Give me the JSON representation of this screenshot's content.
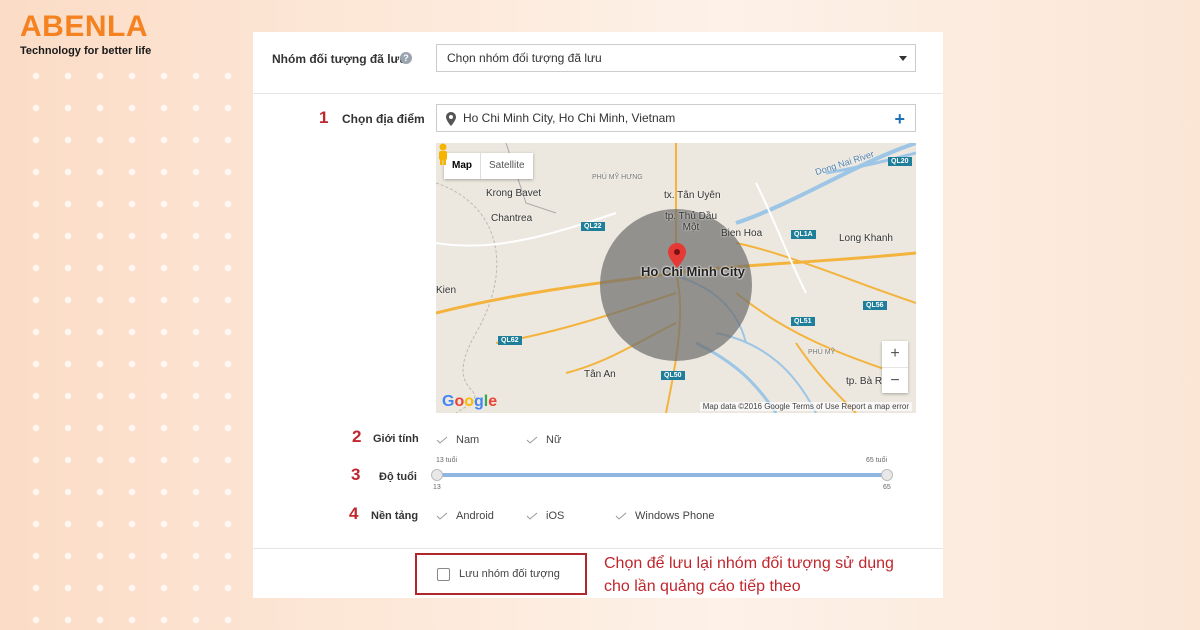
{
  "brand": {
    "name": "ABENLA",
    "tagline": "Technology for better life",
    "color": "#f58220"
  },
  "saved_audience": {
    "label": "Nhóm đối tượng đã lưu",
    "select_value": "Chọn nhóm đối tượng đã lưu"
  },
  "location": {
    "step": "1",
    "label": "Chọn địa điểm",
    "value": "Ho Chi Minh City, Ho Chi Minh, Vietnam",
    "map": {
      "type_map": "Map",
      "type_satellite": "Satellite",
      "city": "Ho Chi Minh City",
      "places": [
        "Krong Bavet",
        "Chantrea",
        "tx. Tân Uyên",
        "tp. Thủ Dầu Một",
        "Bien Hoa",
        "Long Khanh",
        "Tân An",
        "tp. Bà Rịa",
        "Dong Nai River",
        "Kien",
        "PHÚ MỸ HƯNG",
        "PHÚ MỸ"
      ],
      "roads": [
        "QL22",
        "QL1A",
        "QL62",
        "QL50",
        "QL51",
        "QL56",
        "QL20"
      ],
      "attribution": "Map data ©2016 Google   Terms of Use   Report a map error",
      "logo": "Google"
    }
  },
  "gender": {
    "step": "2",
    "label": "Giới tính",
    "options": [
      "Nam",
      "Nữ"
    ]
  },
  "age": {
    "step": "3",
    "label": "Độ tuổi",
    "min_top": "13 tuổi",
    "max_top": "65 tuổi",
    "min": "13",
    "max": "65"
  },
  "platform": {
    "step": "4",
    "label": "Nền tảng",
    "options": [
      "Android",
      "iOS",
      "Windows Phone"
    ]
  },
  "save": {
    "label": "Lưu nhóm đối tượng",
    "note_line1": "Chọn để lưu lại nhóm đối tượng sử dụng",
    "note_line2": "cho lần quảng cáo tiếp theo"
  }
}
